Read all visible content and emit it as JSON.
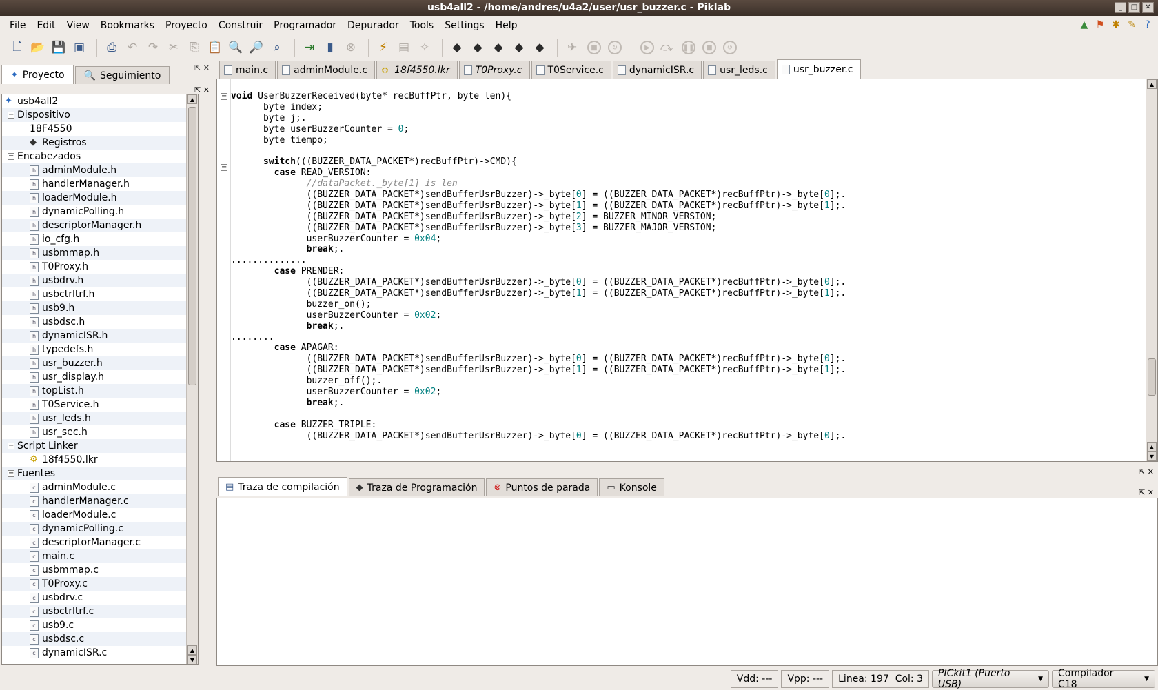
{
  "window": {
    "title": "usb4all2 - /home/andres/u4a2/user/usr_buzzer.c - Piklab"
  },
  "menu": [
    "File",
    "Edit",
    "View",
    "Bookmarks",
    "Proyecto",
    "Construir",
    "Programador",
    "Depurador",
    "Tools",
    "Settings",
    "Help"
  ],
  "left_tabs": [
    {
      "label": "Proyecto",
      "icon": "project-icon",
      "active": true
    },
    {
      "label": "Seguimiento",
      "icon": "magnifier-icon",
      "active": false
    }
  ],
  "tree": [
    {
      "label": "usb4all2",
      "level": 0,
      "icon": "project-icon"
    },
    {
      "label": "Dispositivo",
      "level": 1,
      "expander": "−"
    },
    {
      "label": "18F4550",
      "level": 2
    },
    {
      "label": "Registros",
      "level": 2,
      "icon": "chip-icon"
    },
    {
      "label": "Encabezados",
      "level": 1,
      "expander": "−"
    },
    {
      "label": "adminModule.h",
      "level": 2,
      "icon": "file-h-icon"
    },
    {
      "label": "handlerManager.h",
      "level": 2,
      "icon": "file-h-icon"
    },
    {
      "label": "loaderModule.h",
      "level": 2,
      "icon": "file-h-icon"
    },
    {
      "label": "dynamicPolling.h",
      "level": 2,
      "icon": "file-h-icon"
    },
    {
      "label": "descriptorManager.h",
      "level": 2,
      "icon": "file-h-icon"
    },
    {
      "label": "io_cfg.h",
      "level": 2,
      "icon": "file-h-icon"
    },
    {
      "label": "usbmmap.h",
      "level": 2,
      "icon": "file-h-icon"
    },
    {
      "label": "T0Proxy.h",
      "level": 2,
      "icon": "file-h-icon"
    },
    {
      "label": "usbdrv.h",
      "level": 2,
      "icon": "file-h-icon"
    },
    {
      "label": "usbctrltrf.h",
      "level": 2,
      "icon": "file-h-icon"
    },
    {
      "label": "usb9.h",
      "level": 2,
      "icon": "file-h-icon"
    },
    {
      "label": "usbdsc.h",
      "level": 2,
      "icon": "file-h-icon"
    },
    {
      "label": "dynamicISR.h",
      "level": 2,
      "icon": "file-h-icon"
    },
    {
      "label": "typedefs.h",
      "level": 2,
      "icon": "file-h-icon"
    },
    {
      "label": "usr_buzzer.h",
      "level": 2,
      "icon": "file-h-icon"
    },
    {
      "label": "usr_display.h",
      "level": 2,
      "icon": "file-h-icon"
    },
    {
      "label": "topList.h",
      "level": 2,
      "icon": "file-h-icon"
    },
    {
      "label": "T0Service.h",
      "level": 2,
      "icon": "file-h-icon"
    },
    {
      "label": "usr_leds.h",
      "level": 2,
      "icon": "file-h-icon"
    },
    {
      "label": "usr_sec.h",
      "level": 2,
      "icon": "file-h-icon"
    },
    {
      "label": "Script Linker",
      "level": 1,
      "expander": "−"
    },
    {
      "label": "18f4550.lkr",
      "level": 2,
      "icon": "linker-icon"
    },
    {
      "label": "Fuentes",
      "level": 1,
      "expander": "−"
    },
    {
      "label": "adminModule.c",
      "level": 2,
      "icon": "file-c-icon"
    },
    {
      "label": "handlerManager.c",
      "level": 2,
      "icon": "file-c-icon"
    },
    {
      "label": "loaderModule.c",
      "level": 2,
      "icon": "file-c-icon"
    },
    {
      "label": "dynamicPolling.c",
      "level": 2,
      "icon": "file-c-icon"
    },
    {
      "label": "descriptorManager.c",
      "level": 2,
      "icon": "file-c-icon"
    },
    {
      "label": "main.c",
      "level": 2,
      "icon": "file-c-icon"
    },
    {
      "label": "usbmmap.c",
      "level": 2,
      "icon": "file-c-icon"
    },
    {
      "label": "T0Proxy.c",
      "level": 2,
      "icon": "file-c-icon"
    },
    {
      "label": "usbdrv.c",
      "level": 2,
      "icon": "file-c-icon"
    },
    {
      "label": "usbctrltrf.c",
      "level": 2,
      "icon": "file-c-icon"
    },
    {
      "label": "usb9.c",
      "level": 2,
      "icon": "file-c-icon"
    },
    {
      "label": "usbdsc.c",
      "level": 2,
      "icon": "file-c-icon"
    },
    {
      "label": "dynamicISR.c",
      "level": 2,
      "icon": "file-c-icon"
    }
  ],
  "file_tabs": [
    {
      "label": "main.c",
      "active": false
    },
    {
      "label": "adminModule.c",
      "active": false
    },
    {
      "label": "18f4550.lkr",
      "active": false,
      "italic": true,
      "lkr": true
    },
    {
      "label": "T0Proxy.c",
      "active": false,
      "italic": true
    },
    {
      "label": "T0Service.c",
      "active": false
    },
    {
      "label": "dynamicISR.c",
      "active": false
    },
    {
      "label": "usr_leds.c",
      "active": false
    },
    {
      "label": "usr_buzzer.c",
      "active": true
    }
  ],
  "code_lines": [
    "void UserBuzzerReceived(byte* recBuffPtr, byte len){",
    "      byte index;",
    "      byte j;.",
    "      byte userBuzzerCounter = 0;",
    "      byte tiempo;",
    "",
    "      switch(((BUZZER_DATA_PACKET*)recBuffPtr)->CMD){",
    "        case READ_VERSION:",
    "              //dataPacket._byte[1] is len",
    "              ((BUZZER_DATA_PACKET*)sendBufferUsrBuzzer)->_byte[0] = ((BUZZER_DATA_PACKET*)recBuffPtr)->_byte[0];.",
    "              ((BUZZER_DATA_PACKET*)sendBufferUsrBuzzer)->_byte[1] = ((BUZZER_DATA_PACKET*)recBuffPtr)->_byte[1];.",
    "              ((BUZZER_DATA_PACKET*)sendBufferUsrBuzzer)->_byte[2] = BUZZER_MINOR_VERSION;",
    "              ((BUZZER_DATA_PACKET*)sendBufferUsrBuzzer)->_byte[3] = BUZZER_MAJOR_VERSION;",
    "              userBuzzerCounter = 0x04;",
    "              break;.",
    "..............",
    "        case PRENDER:",
    "              ((BUZZER_DATA_PACKET*)sendBufferUsrBuzzer)->_byte[0] = ((BUZZER_DATA_PACKET*)recBuffPtr)->_byte[0];.",
    "              ((BUZZER_DATA_PACKET*)sendBufferUsrBuzzer)->_byte[1] = ((BUZZER_DATA_PACKET*)recBuffPtr)->_byte[1];.",
    "              buzzer_on();",
    "              userBuzzerCounter = 0x02;",
    "              break;.",
    "........",
    "        case APAGAR:",
    "              ((BUZZER_DATA_PACKET*)sendBufferUsrBuzzer)->_byte[0] = ((BUZZER_DATA_PACKET*)recBuffPtr)->_byte[0];.",
    "              ((BUZZER_DATA_PACKET*)sendBufferUsrBuzzer)->_byte[1] = ((BUZZER_DATA_PACKET*)recBuffPtr)->_byte[1];.",
    "              buzzer_off();.",
    "              userBuzzerCounter = 0x02;",
    "              break;.",
    "",
    "        case BUZZER_TRIPLE:",
    "              ((BUZZER_DATA_PACKET*)sendBufferUsrBuzzer)->_byte[0] = ((BUZZER_DATA_PACKET*)recBuffPtr)->_byte[0];."
  ],
  "bottom_tabs": [
    {
      "label": "Traza de compilación",
      "icon": "compile-icon",
      "active": true
    },
    {
      "label": "Traza de Programación",
      "icon": "chip-icon",
      "active": false
    },
    {
      "label": "Puntos de parada",
      "icon": "breakpoint-icon",
      "active": false
    },
    {
      "label": "Konsole",
      "icon": "terminal-icon",
      "active": false
    }
  ],
  "status": {
    "vdd": "Vdd: ---",
    "vpp": "Vpp: ---",
    "line": "Linea: 197",
    "col": "Col: 3",
    "programmer": "PICkit1 (Puerto USB)",
    "compiler": "Compilador C18"
  }
}
